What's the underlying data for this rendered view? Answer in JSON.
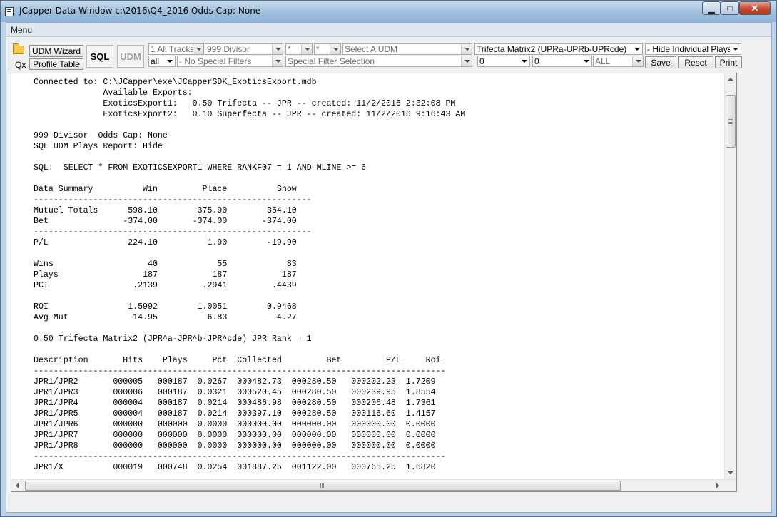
{
  "window": {
    "title": "JCapper Data Window c:\\2016\\Q4_2016 Odds Cap: None",
    "minimize": "▁",
    "maximize": "□",
    "close": "✕"
  },
  "menu": {
    "label": "Menu"
  },
  "toolbar": {
    "udm_wizard": "UDM Wizard",
    "profile_table": "Profile Table",
    "qx": "Qx",
    "sql": "SQL",
    "udm": "UDM",
    "tracks": "1 All Tracks",
    "divisor": "999 Divisor",
    "star1": "*",
    "star2": "*",
    "select_udm": "Select A UDM",
    "matrix": "Trifecta Matrix2 (UPRa-UPRb-UPRcde)",
    "hide_plays": "- Hide Individual Plays",
    "all": "all",
    "no_special_filters": "- No Special Filters",
    "special_filter_selection": "Special Filter Selection",
    "zero1": "0",
    "zero2": "0",
    "all_caps": "ALL",
    "save": "Save",
    "reset": "Reset",
    "print": "Print"
  },
  "report": {
    "lines": [
      "Connected to: C:\\JCapper\\exe\\JCapperSDK_ExoticsExport.mdb",
      "              Available Exports:",
      "              ExoticsExport1:   0.50 Trifecta -- JPR -- created: 11/2/2016 2:32:08 PM",
      "              ExoticsExport2:   0.10 Superfecta -- JPR -- created: 11/2/2016 9:16:43 AM",
      "",
      "999 Divisor  Odds Cap: None",
      "SQL UDM Plays Report: Hide",
      "",
      "SQL:  SELECT * FROM EXOTICSEXPORT1 WHERE RANKF07 = 1 AND MLINE >= 6",
      "",
      "Data Summary          Win         Place          Show",
      "--------------------------------------------------------",
      "Mutuel Totals      598.10        375.90        354.10",
      "Bet               -374.00       -374.00       -374.00",
      "--------------------------------------------------------",
      "P/L                224.10          1.90        -19.90",
      "",
      "Wins                   40            55            83",
      "Plays                 187           187           187",
      "PCT                 .2139         .2941         .4439",
      "",
      "ROI                1.5992        1.0051        0.9468",
      "Avg Mut             14.95          6.83          4.27",
      "",
      "0.50 Trifecta Matrix2 (JPR^a-JPR^b-JPR^cde) JPR Rank = 1",
      "",
      "Description       Hits    Plays     Pct  Collected         Bet         P/L     Roi",
      "-----------------------------------------------------------------------------------",
      "JPR1/JPR2       000005   000187  0.0267  000482.73  000280.50   000202.23  1.7209",
      "JPR1/JPR3       000006   000187  0.0321  000520.45  000280.50   000239.95  1.8554",
      "JPR1/JPR4       000004   000187  0.0214  000486.98  000280.50   000206.48  1.7361",
      "JPR1/JPR5       000004   000187  0.0214  000397.10  000280.50   000116.60  1.4157",
      "JPR1/JPR6       000000   000000  0.0000  000000.00  000000.00   000000.00  0.0000",
      "JPR1/JPR7       000000   000000  0.0000  000000.00  000000.00   000000.00  0.0000",
      "JPR1/JPR8       000000   000000  0.0000  000000.00  000000.00   000000.00  0.0000",
      "-----------------------------------------------------------------------------------",
      "JPR1/X          000019   000748  0.0254  001887.25  001122.00   000765.25  1.6820"
    ]
  }
}
